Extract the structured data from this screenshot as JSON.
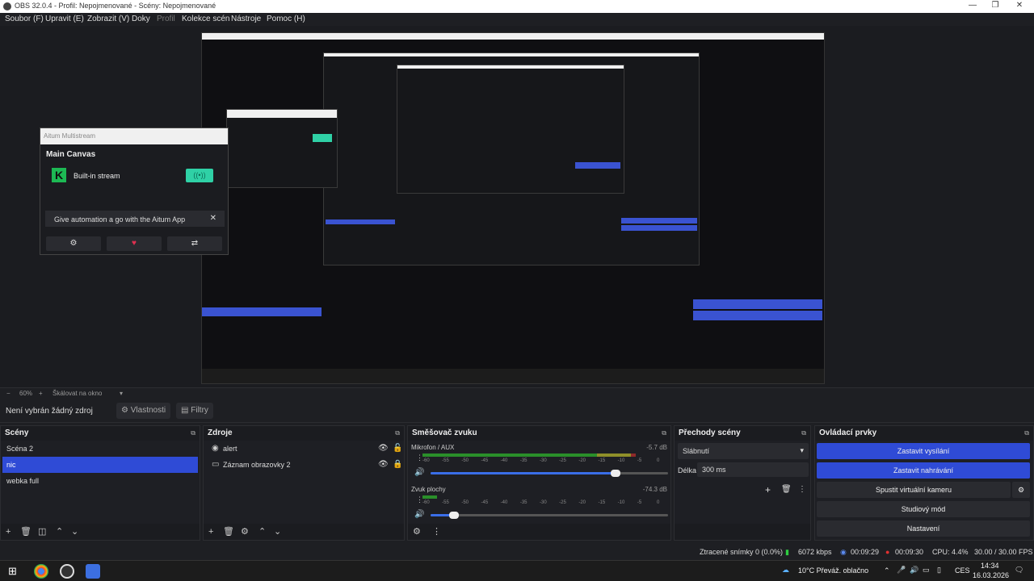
{
  "window": {
    "title": "OBS 32.0.4 - Profil: Nepojmenované - Scény: Nepojmenované",
    "minimize": "—",
    "maximize": "❐",
    "close": "✕"
  },
  "menu": [
    "Soubor (F)",
    "Upravit (E)",
    "Zobrazit (V)",
    "Doky",
    "Profil",
    "Kolekce scén",
    "Nástroje",
    "Pomoc (H)"
  ],
  "aitum": {
    "window_title": "Aitum Multistream",
    "canvas_title": "Main Canvas",
    "stream_name": "Built-in stream",
    "stream_button_icon": "((•))",
    "automation_text": "Give automation a go with the Aitum App",
    "close_icon": "✕",
    "footer_icons": [
      "⚙",
      "♥",
      "⇄"
    ]
  },
  "zoom": {
    "minus": "−",
    "level": "60%",
    "plus": "+",
    "mode": "Škálovat na okno",
    "dropdown": "▾"
  },
  "context": {
    "no_source": "Není vybrán žádný zdroj",
    "properties": "Vlastnosti",
    "filters": "Filtry"
  },
  "scenes": {
    "title": "Scény",
    "items": [
      "Scéna 2",
      "nic",
      "webka full"
    ],
    "selected_index": 1
  },
  "sources": {
    "title": "Zdroje",
    "items": [
      {
        "icon": "alert-icon",
        "glyph": "◉",
        "label": "alert"
      },
      {
        "icon": "display-capture-icon",
        "glyph": "▭",
        "label": "Záznam obrazovky 2"
      }
    ]
  },
  "mixer": {
    "title": "Směšovač zvuku",
    "channels": [
      {
        "name": "Mikrofon / AUX",
        "db": "-5.7 dB",
        "volume": 0.78,
        "level": 0.88
      },
      {
        "name": "Zvuk plochy",
        "db": "-74.3 dB",
        "volume": 0.1,
        "level": 0.06
      }
    ],
    "ticks": [
      "-60",
      "-55",
      "-50",
      "-45",
      "-40",
      "-35",
      "-30",
      "-25",
      "-20",
      "-15",
      "-10",
      "-5",
      "0"
    ]
  },
  "transitions": {
    "title": "Přechody scény",
    "selected": "Slábnutí",
    "duration_label": "Délka",
    "duration_value": "300 ms"
  },
  "controls": {
    "title": "Ovládací prvky",
    "buttons": [
      {
        "label": "Zastavit vysílání",
        "active": true
      },
      {
        "label": "Zastavit nahrávání",
        "active": true
      },
      {
        "label": "Spustit virtuální kameru",
        "active": false
      },
      {
        "label": "Studiový mód",
        "active": false
      },
      {
        "label": "Nastavení",
        "active": false
      }
    ]
  },
  "status": {
    "dropped": "Ztracené snímky 0 (0.0%)",
    "bitrate": "6072 kbps",
    "stream_time": "00:09:29",
    "rec_time": "00:09:30",
    "cpu": "CPU: 4.4%",
    "fps": "30.00 / 30.00 FPS"
  },
  "taskbar": {
    "weather": "10°C  Převáž. oblačno",
    "lang": "CES",
    "time": "14:34",
    "date": "16.03.2026"
  },
  "colors": {
    "accent": "#2f4bd6",
    "background": "#1e1f23",
    "aitum_green": "#2fd1a6"
  }
}
